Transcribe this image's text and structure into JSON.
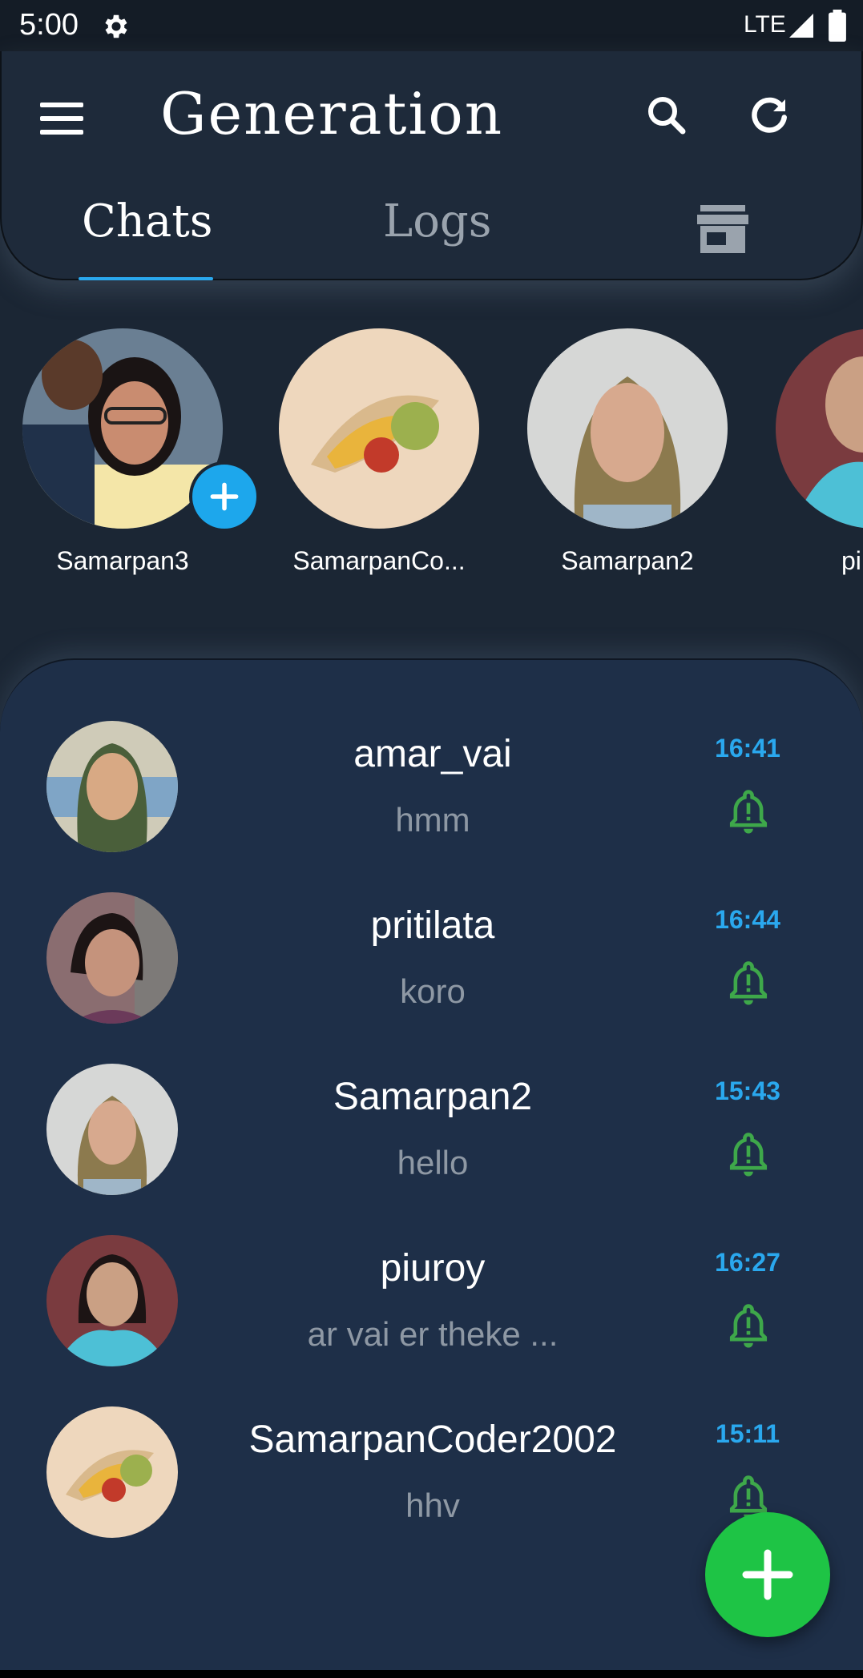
{
  "status_bar": {
    "time": "5:00",
    "network": "LTE"
  },
  "app_bar": {
    "title": "Generation",
    "tabs": [
      {
        "label": "Chats",
        "active": true
      },
      {
        "label": "Logs",
        "active": false
      },
      {
        "icon": "store-icon",
        "active": false
      }
    ]
  },
  "stories": [
    {
      "name": "Samarpan3",
      "has_add": true
    },
    {
      "name": "SamarpanCo..."
    },
    {
      "name": "Samarpan2"
    },
    {
      "name": "pi"
    }
  ],
  "chats": [
    {
      "name": "amar_vai",
      "message": "hmm",
      "time": "16:41"
    },
    {
      "name": "pritilata",
      "message": "koro",
      "time": "16:44"
    },
    {
      "name": "Samarpan2",
      "message": "hello",
      "time": "15:43"
    },
    {
      "name": "piuroy",
      "message": "ar vai er theke ...",
      "time": "16:27"
    },
    {
      "name": "SamarpanCoder2002",
      "message": "hhv",
      "time": "15:11"
    }
  ],
  "colors": {
    "accent": "#2aa8ee",
    "fab": "#1ec445",
    "bell": "#3ea84a"
  }
}
